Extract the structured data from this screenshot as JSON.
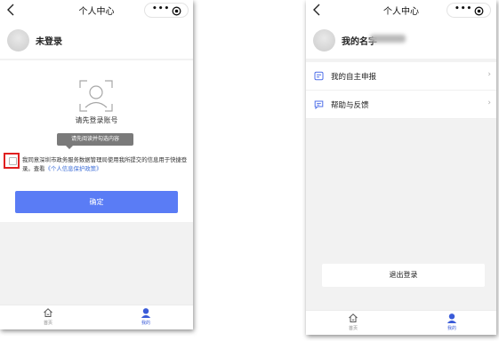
{
  "colors": {
    "accent": "#5a7cf5",
    "tab_active": "#3a5bd8",
    "checkbox_highlight": "#e02020",
    "background": "#f2f2f2"
  },
  "left_screen": {
    "header": {
      "title": "个人中心",
      "back_icon": "chevron-left-icon",
      "more_icon": "more-dots-icon",
      "close_icon": "target-icon"
    },
    "user": {
      "name": "未登录",
      "avatar_icon": "avatar"
    },
    "login": {
      "icon": "face-scan-icon",
      "prompt": "请先登录账号",
      "tooltip": "请先阅读并勾选内容",
      "agreement_text": "我同意深圳市政务服务数据管理局使用我所提交的信息用于快捷登录。查看",
      "policy_link": "《个人信息保护政策》",
      "confirm_label": "确定"
    },
    "tabbar": {
      "home_label": "首页",
      "mine_label": "我的"
    }
  },
  "right_screen": {
    "header": {
      "title": "个人中心"
    },
    "user": {
      "name": "我的名字"
    },
    "menu": [
      {
        "label": "我的自主申报",
        "icon": "declaration-icon"
      },
      {
        "label": "帮助与反馈",
        "icon": "feedback-icon"
      }
    ],
    "logout_label": "退出登录",
    "tabbar": {
      "home_label": "首页",
      "mine_label": "我的"
    }
  }
}
